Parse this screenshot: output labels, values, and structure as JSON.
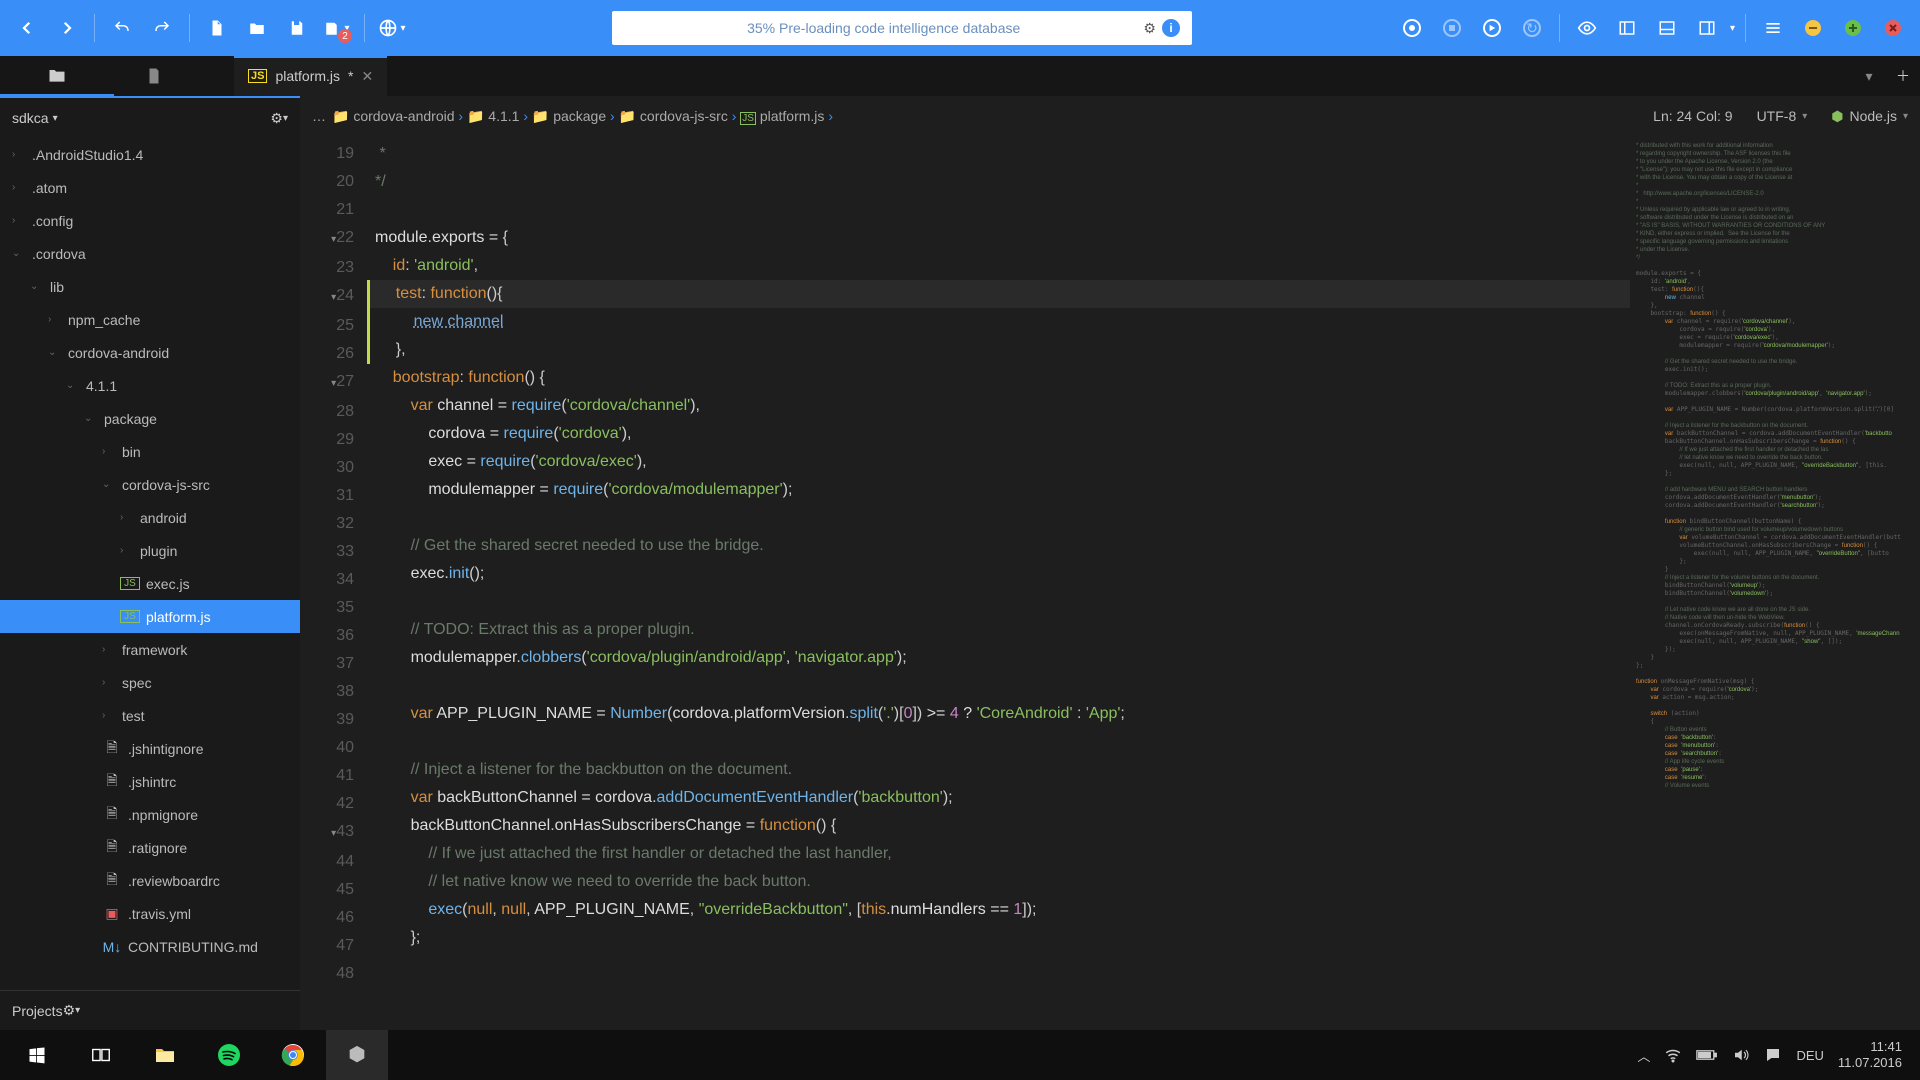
{
  "toolbar": {
    "loading_text": "35% Pre-loading code intelligence database"
  },
  "tab": {
    "filename": "platform.js",
    "modified": "*"
  },
  "sidebar": {
    "project": "sdkca",
    "footer": "Projects",
    "items": [
      {
        "label": ".AndroidStudio1.4",
        "indent": 0,
        "chev": "›"
      },
      {
        "label": ".atom",
        "indent": 0,
        "chev": "›"
      },
      {
        "label": ".config",
        "indent": 0,
        "chev": "›"
      },
      {
        "label": ".cordova",
        "indent": 0,
        "chev": "⌄"
      },
      {
        "label": "lib",
        "indent": 1,
        "chev": "⌄"
      },
      {
        "label": "npm_cache",
        "indent": 2,
        "chev": "›"
      },
      {
        "label": "cordova-android",
        "indent": 2,
        "chev": "⌄"
      },
      {
        "label": "4.1.1",
        "indent": 3,
        "chev": "⌄"
      },
      {
        "label": "package",
        "indent": 4,
        "chev": "⌄"
      },
      {
        "label": "bin",
        "indent": 5,
        "chev": "›"
      },
      {
        "label": "cordova-js-src",
        "indent": 5,
        "chev": "⌄"
      },
      {
        "label": "android",
        "indent": 6,
        "chev": "›"
      },
      {
        "label": "plugin",
        "indent": 6,
        "chev": "›"
      },
      {
        "label": "exec.js",
        "indent": 6,
        "icon": "js"
      },
      {
        "label": "platform.js",
        "indent": 6,
        "icon": "js",
        "sel": true
      },
      {
        "label": "framework",
        "indent": 5,
        "chev": "›"
      },
      {
        "label": "spec",
        "indent": 5,
        "chev": "›"
      },
      {
        "label": "test",
        "indent": 5,
        "chev": "›"
      },
      {
        "label": ".jshintignore",
        "indent": 5,
        "icon": "f"
      },
      {
        "label": ".jshintrc",
        "indent": 5,
        "icon": "f"
      },
      {
        "label": ".npmignore",
        "indent": 5,
        "icon": "f"
      },
      {
        "label": ".ratignore",
        "indent": 5,
        "icon": "f"
      },
      {
        "label": ".reviewboardrc",
        "indent": 5,
        "icon": "f"
      },
      {
        "label": ".travis.yml",
        "indent": 5,
        "icon": "y"
      },
      {
        "label": "CONTRIBUTING.md",
        "indent": 5,
        "icon": "m"
      }
    ]
  },
  "crumbs": {
    "parts": [
      "cordova-android",
      "4.1.1",
      "package",
      "cordova-js-src",
      "platform.js"
    ],
    "status": "Ln: 24 Col: 9",
    "encoding": "UTF-8",
    "lang": "Node.js"
  },
  "code_lines": [
    {
      "n": 19,
      "html": "<span class='c-com'> *</span>"
    },
    {
      "n": 20,
      "html": "<span class='c-com'>*/</span>"
    },
    {
      "n": 21,
      "html": ""
    },
    {
      "n": 22,
      "fold": true,
      "html": "<span class='c-id'>module</span>.<span class='c-id'>exports</span> <span class='c-op'>=</span> {"
    },
    {
      "n": 23,
      "html": "    <span class='c-prop'>id</span>: <span class='c-str'>'android'</span>,"
    },
    {
      "n": 24,
      "fold": true,
      "cur": true,
      "mod": true,
      "html": "    <span class='c-prop'>test</span>: <span class='c-kw'>function</span>(){"
    },
    {
      "n": 25,
      "mod": true,
      "html": "        <span class='c-new'>new channel</span>"
    },
    {
      "n": 26,
      "mod": true,
      "html": "    },"
    },
    {
      "n": 27,
      "fold": true,
      "html": "    <span class='c-prop'>bootstrap</span>: <span class='c-kw'>function</span>() {"
    },
    {
      "n": 28,
      "html": "        <span class='c-kw'>var</span> <span class='c-id'>channel</span> <span class='c-op'>=</span> <span class='c-fn'>require</span>(<span class='c-str'>'cordova/channel'</span>),"
    },
    {
      "n": 29,
      "html": "            <span class='c-id'>cordova</span> <span class='c-op'>=</span> <span class='c-fn'>require</span>(<span class='c-str'>'cordova'</span>),"
    },
    {
      "n": 30,
      "html": "            <span class='c-id'>exec</span> <span class='c-op'>=</span> <span class='c-fn'>require</span>(<span class='c-str'>'cordova/exec'</span>),"
    },
    {
      "n": 31,
      "html": "            <span class='c-id'>modulemapper</span> <span class='c-op'>=</span> <span class='c-fn'>require</span>(<span class='c-str'>'cordova/modulemapper'</span>);"
    },
    {
      "n": 32,
      "html": ""
    },
    {
      "n": 33,
      "html": "        <span class='c-com'>// Get the shared secret needed to use the bridge.</span>"
    },
    {
      "n": 34,
      "html": "        <span class='c-id'>exec</span>.<span class='c-fn'>init</span>();"
    },
    {
      "n": 35,
      "html": ""
    },
    {
      "n": 36,
      "html": "        <span class='c-com'>// TODO: Extract this as a proper plugin.</span>"
    },
    {
      "n": 37,
      "html": "        <span class='c-id'>modulemapper</span>.<span class='c-fn'>clobbers</span>(<span class='c-str'>'cordova/plugin/android/app'</span>, <span class='c-str'>'navigator.app'</span>);"
    },
    {
      "n": 38,
      "html": ""
    },
    {
      "n": 39,
      "html": "        <span class='c-kw'>var</span> <span class='c-id'>APP_PLUGIN_NAME</span> <span class='c-op'>=</span> <span class='c-fn'>Number</span>(<span class='c-id'>cordova</span>.<span class='c-id'>platformVersion</span>.<span class='c-fn'>split</span>(<span class='c-str'>'.'</span>)[<span class='c-num'>0</span>]) <span class='c-op'>&gt;=</span> <span class='c-num'>4</span> <span class='c-op'>?</span> <span class='c-str'>'CoreAndroid'</span> : <span class='c-str'>'App'</span>;"
    },
    {
      "n": 40,
      "html": ""
    },
    {
      "n": 41,
      "html": "        <span class='c-com'>// Inject a listener for the backbutton on the document.</span>"
    },
    {
      "n": 42,
      "html": "        <span class='c-kw'>var</span> <span class='c-id'>backButtonChannel</span> <span class='c-op'>=</span> <span class='c-id'>cordova</span>.<span class='c-fn'>addDocumentEventHandler</span>(<span class='c-str'>'backbutton'</span>);"
    },
    {
      "n": 43,
      "fold": true,
      "html": "        <span class='c-id'>backButtonChannel</span>.<span class='c-id'>onHasSubscribersChange</span> <span class='c-op'>=</span> <span class='c-kw'>function</span>() {"
    },
    {
      "n": 44,
      "html": "            <span class='c-com'>// If we just attached the first handler or detached the last handler,</span>"
    },
    {
      "n": 45,
      "html": "            <span class='c-com'>// let native know we need to override the back button.</span>"
    },
    {
      "n": 46,
      "html": "            <span class='c-fn'>exec</span>(<span class='c-kw'>null</span>, <span class='c-kw'>null</span>, <span class='c-id'>APP_PLUGIN_NAME</span>, <span class='c-str'>\"overrideBackbutton\"</span>, [<span class='c-kw'>this</span>.<span class='c-id'>numHandlers</span> <span class='c-op'>==</span> <span class='c-num'>1</span>]);"
    },
    {
      "n": 47,
      "html": "        };"
    },
    {
      "n": 48,
      "html": ""
    }
  ],
  "tray": {
    "lang": "DEU",
    "time": "11:41",
    "date": "11.07.2016"
  }
}
